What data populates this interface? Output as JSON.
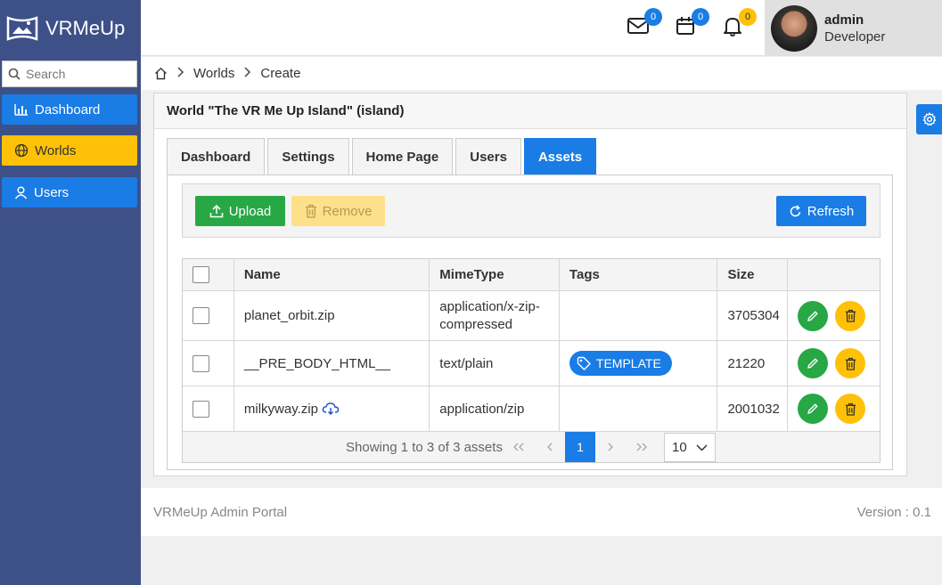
{
  "app": {
    "name": "VRMeUp"
  },
  "search": {
    "placeholder": "Search"
  },
  "sidebar": {
    "items": [
      {
        "label": "Dashboard",
        "icon": "bar-chart-icon"
      },
      {
        "label": "Worlds",
        "icon": "globe-icon"
      },
      {
        "label": "Users",
        "icon": "user-icon"
      }
    ]
  },
  "header": {
    "mail_count": "0",
    "calendar_count": "0",
    "bell_count": "0",
    "user": {
      "name": "admin",
      "role": "Developer"
    }
  },
  "breadcrumb": {
    "items": [
      "Worlds",
      "Create"
    ]
  },
  "card": {
    "title": "World \"The VR Me Up Island\" (island)"
  },
  "tabs": [
    "Dashboard",
    "Settings",
    "Home Page",
    "Users",
    "Assets"
  ],
  "active_tab": "Assets",
  "toolbar": {
    "upload": "Upload",
    "remove": "Remove",
    "refresh": "Refresh"
  },
  "table": {
    "columns": [
      "Name",
      "MimeType",
      "Tags",
      "Size"
    ],
    "rows": [
      {
        "name": "planet_orbit.zip",
        "mime": "application/x-zip-compressed",
        "tag": "",
        "size": "3705304"
      },
      {
        "name": "__PRE_BODY_HTML__",
        "mime": "text/plain",
        "tag": "TEMPLATE",
        "size": "21220"
      },
      {
        "name": "milkyway.zip",
        "mime": "application/zip",
        "tag": "",
        "size": "2001032"
      }
    ]
  },
  "pager": {
    "text": "Showing 1 to 3 of 3 assets",
    "current_page": "1",
    "page_size": "10"
  },
  "footer": {
    "left": "VRMeUp Admin Portal",
    "right": "Version : 0.1"
  },
  "colors": {
    "sidebar": "#3e5088",
    "primary": "#1a7ce5",
    "success": "#28a745",
    "warning": "#ffc107"
  }
}
